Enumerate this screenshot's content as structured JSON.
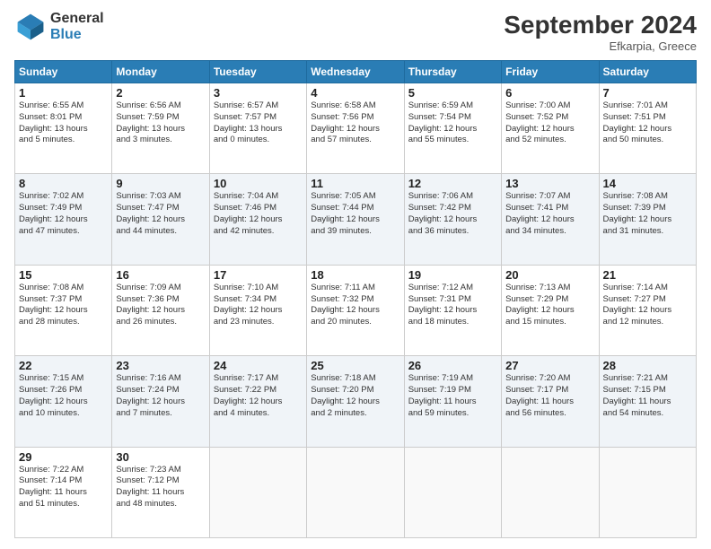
{
  "header": {
    "logo_general": "General",
    "logo_blue": "Blue",
    "month_title": "September 2024",
    "location": "Efkarpia, Greece"
  },
  "days_of_week": [
    "Sunday",
    "Monday",
    "Tuesday",
    "Wednesday",
    "Thursday",
    "Friday",
    "Saturday"
  ],
  "weeks": [
    [
      {
        "day": "1",
        "info": "Sunrise: 6:55 AM\nSunset: 8:01 PM\nDaylight: 13 hours\nand 5 minutes."
      },
      {
        "day": "2",
        "info": "Sunrise: 6:56 AM\nSunset: 7:59 PM\nDaylight: 13 hours\nand 3 minutes."
      },
      {
        "day": "3",
        "info": "Sunrise: 6:57 AM\nSunset: 7:57 PM\nDaylight: 13 hours\nand 0 minutes."
      },
      {
        "day": "4",
        "info": "Sunrise: 6:58 AM\nSunset: 7:56 PM\nDaylight: 12 hours\nand 57 minutes."
      },
      {
        "day": "5",
        "info": "Sunrise: 6:59 AM\nSunset: 7:54 PM\nDaylight: 12 hours\nand 55 minutes."
      },
      {
        "day": "6",
        "info": "Sunrise: 7:00 AM\nSunset: 7:52 PM\nDaylight: 12 hours\nand 52 minutes."
      },
      {
        "day": "7",
        "info": "Sunrise: 7:01 AM\nSunset: 7:51 PM\nDaylight: 12 hours\nand 50 minutes."
      }
    ],
    [
      {
        "day": "8",
        "info": "Sunrise: 7:02 AM\nSunset: 7:49 PM\nDaylight: 12 hours\nand 47 minutes."
      },
      {
        "day": "9",
        "info": "Sunrise: 7:03 AM\nSunset: 7:47 PM\nDaylight: 12 hours\nand 44 minutes."
      },
      {
        "day": "10",
        "info": "Sunrise: 7:04 AM\nSunset: 7:46 PM\nDaylight: 12 hours\nand 42 minutes."
      },
      {
        "day": "11",
        "info": "Sunrise: 7:05 AM\nSunset: 7:44 PM\nDaylight: 12 hours\nand 39 minutes."
      },
      {
        "day": "12",
        "info": "Sunrise: 7:06 AM\nSunset: 7:42 PM\nDaylight: 12 hours\nand 36 minutes."
      },
      {
        "day": "13",
        "info": "Sunrise: 7:07 AM\nSunset: 7:41 PM\nDaylight: 12 hours\nand 34 minutes."
      },
      {
        "day": "14",
        "info": "Sunrise: 7:08 AM\nSunset: 7:39 PM\nDaylight: 12 hours\nand 31 minutes."
      }
    ],
    [
      {
        "day": "15",
        "info": "Sunrise: 7:08 AM\nSunset: 7:37 PM\nDaylight: 12 hours\nand 28 minutes."
      },
      {
        "day": "16",
        "info": "Sunrise: 7:09 AM\nSunset: 7:36 PM\nDaylight: 12 hours\nand 26 minutes."
      },
      {
        "day": "17",
        "info": "Sunrise: 7:10 AM\nSunset: 7:34 PM\nDaylight: 12 hours\nand 23 minutes."
      },
      {
        "day": "18",
        "info": "Sunrise: 7:11 AM\nSunset: 7:32 PM\nDaylight: 12 hours\nand 20 minutes."
      },
      {
        "day": "19",
        "info": "Sunrise: 7:12 AM\nSunset: 7:31 PM\nDaylight: 12 hours\nand 18 minutes."
      },
      {
        "day": "20",
        "info": "Sunrise: 7:13 AM\nSunset: 7:29 PM\nDaylight: 12 hours\nand 15 minutes."
      },
      {
        "day": "21",
        "info": "Sunrise: 7:14 AM\nSunset: 7:27 PM\nDaylight: 12 hours\nand 12 minutes."
      }
    ],
    [
      {
        "day": "22",
        "info": "Sunrise: 7:15 AM\nSunset: 7:26 PM\nDaylight: 12 hours\nand 10 minutes."
      },
      {
        "day": "23",
        "info": "Sunrise: 7:16 AM\nSunset: 7:24 PM\nDaylight: 12 hours\nand 7 minutes."
      },
      {
        "day": "24",
        "info": "Sunrise: 7:17 AM\nSunset: 7:22 PM\nDaylight: 12 hours\nand 4 minutes."
      },
      {
        "day": "25",
        "info": "Sunrise: 7:18 AM\nSunset: 7:20 PM\nDaylight: 12 hours\nand 2 minutes."
      },
      {
        "day": "26",
        "info": "Sunrise: 7:19 AM\nSunset: 7:19 PM\nDaylight: 11 hours\nand 59 minutes."
      },
      {
        "day": "27",
        "info": "Sunrise: 7:20 AM\nSunset: 7:17 PM\nDaylight: 11 hours\nand 56 minutes."
      },
      {
        "day": "28",
        "info": "Sunrise: 7:21 AM\nSunset: 7:15 PM\nDaylight: 11 hours\nand 54 minutes."
      }
    ],
    [
      {
        "day": "29",
        "info": "Sunrise: 7:22 AM\nSunset: 7:14 PM\nDaylight: 11 hours\nand 51 minutes."
      },
      {
        "day": "30",
        "info": "Sunrise: 7:23 AM\nSunset: 7:12 PM\nDaylight: 11 hours\nand 48 minutes."
      },
      {
        "day": "",
        "info": ""
      },
      {
        "day": "",
        "info": ""
      },
      {
        "day": "",
        "info": ""
      },
      {
        "day": "",
        "info": ""
      },
      {
        "day": "",
        "info": ""
      }
    ]
  ]
}
